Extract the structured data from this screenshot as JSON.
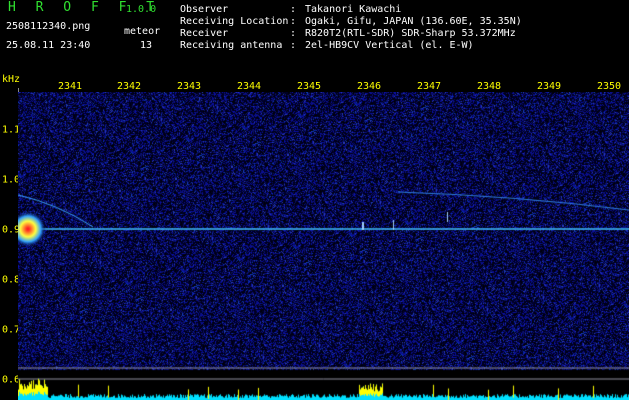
{
  "app": {
    "name": "H R O F F T",
    "version": "1.0.0"
  },
  "file": {
    "name": "2508112340.png",
    "datetime": "25.08.11 23:40"
  },
  "meteor": {
    "label": "meteor",
    "count": "13"
  },
  "info": [
    {
      "label": "Observer",
      "value": "Takanori Kawachi"
    },
    {
      "label": "Receiving Location",
      "value": "Ogaki, Gifu, JAPAN (136.60E, 35.35N)"
    },
    {
      "label": "Receiver",
      "value": "R820T2(RTL-SDR) SDR-Sharp 53.372MHz"
    },
    {
      "label": "Receiving antenna",
      "value": "2el-HB9CV Vertical (el. E-W)"
    }
  ],
  "axis": {
    "ylabel": "kHz",
    "xticks": [
      "2341",
      "2342",
      "2343",
      "2344",
      "2345",
      "2346",
      "2347",
      "2348",
      "2349",
      "2350"
    ],
    "yticks": [
      "1.1",
      "1.0",
      "0.9",
      "0.8",
      "0.7",
      "0.6"
    ]
  },
  "colors": {
    "title": "#30e030",
    "axis_text": "#ffff00",
    "carrier": "#40c0ff",
    "background_noise": "#10107a",
    "signal_strip": "#00e0ff",
    "peak": "#ffff00"
  }
}
